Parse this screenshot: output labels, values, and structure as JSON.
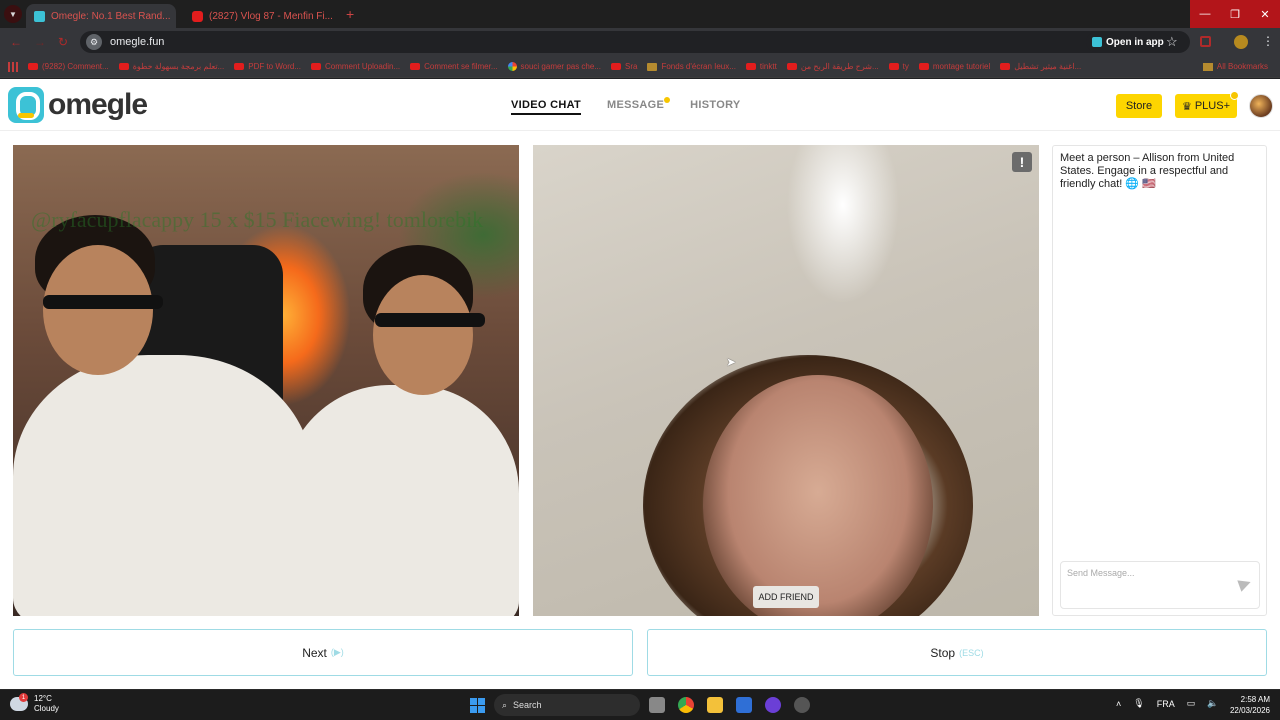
{
  "browser": {
    "tabs": [
      {
        "title": "Omegle: No.1 Best Rand...",
        "active": true
      },
      {
        "title": "(2827) Vlog 87 - Menfin Fi...",
        "active": false
      }
    ],
    "url": "omegle.fun",
    "open_in_app": "Open in app",
    "bookmarks": [
      {
        "label": "(9282) Comment...",
        "icon": "youtube"
      },
      {
        "label": "تعلم برمجة بسهولة خطوة...",
        "icon": "youtube"
      },
      {
        "label": "PDF to Word...",
        "icon": "youtube"
      },
      {
        "label": "Comment Uploadin...",
        "icon": "youtube"
      },
      {
        "label": "Comment se filmer...",
        "icon": "youtube"
      },
      {
        "label": "souci gamer pas che...",
        "icon": "google"
      },
      {
        "label": "Sra",
        "icon": "youtube"
      },
      {
        "label": "Fonds d'écran Ieux...",
        "icon": "folder"
      },
      {
        "label": "tinktt",
        "icon": "youtube"
      },
      {
        "label": "شرح طريقة الربح من...",
        "icon": "youtube"
      },
      {
        "label": "ty",
        "icon": "youtube"
      },
      {
        "label": "montage tutoriel",
        "icon": "youtube"
      },
      {
        "label": "اغنية ميثير تشطيل...",
        "icon": "youtube"
      }
    ],
    "all_bookmarks": "All Bookmarks"
  },
  "header": {
    "logo_text": "omegle",
    "nav": [
      {
        "label": "VIDEO CHAT",
        "active": true
      },
      {
        "label": "MESSAGE",
        "active": false,
        "dot": true
      },
      {
        "label": "HISTORY",
        "active": false
      }
    ],
    "store_label": "Store",
    "plus_label": "PLUS+",
    "plus_icon": "♛"
  },
  "video": {
    "overlay_text": "@ryfacupflacappy 15 x $15 Fiacewing! tomlorebik",
    "report_icon": "!",
    "add_friend": "ADD FRIEND"
  },
  "chat": {
    "intro": "Meet a person – Allison from United States. Engage in a respectful and friendly chat! 🌐 🇺🇸",
    "input_placeholder": "Send Message..."
  },
  "controls": {
    "next_label": "Next",
    "next_hint": "(▶)",
    "stop_label": "Stop",
    "stop_hint": "(ESC)"
  },
  "taskbar": {
    "temperature": "12°C",
    "weather": "Cloudy",
    "search": "Search",
    "language": "FRA",
    "time": "2:58 AM",
    "date": "22/03/2026"
  },
  "colors": {
    "accent_yellow": "#fdd500",
    "accent_cyan": "#3cc2d6",
    "button_border": "#9fdbe5"
  }
}
